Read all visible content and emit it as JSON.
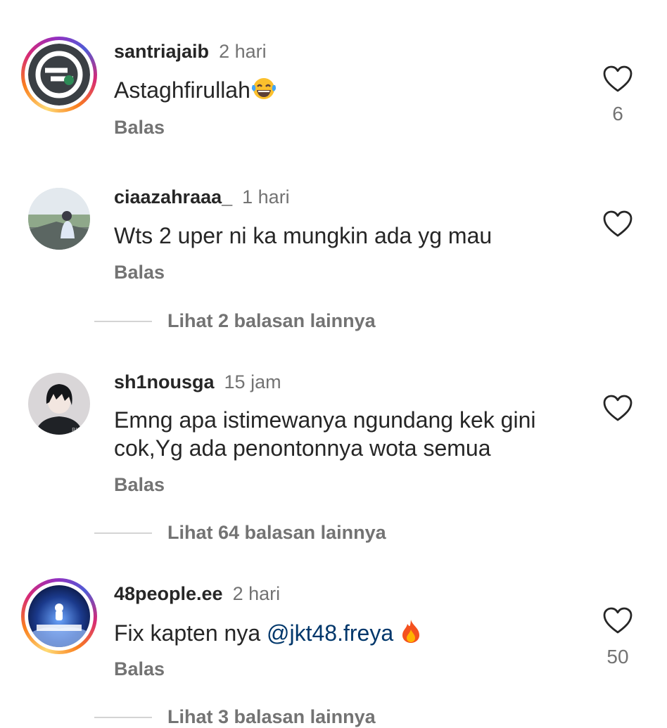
{
  "comments": [
    {
      "username": "santriajaib",
      "time": "2 hari",
      "text": "Astaghfirullah",
      "emoji": "tears-of-joy-emoji",
      "reply_label": "Balas",
      "likes": "6"
    },
    {
      "username": "ciaazahraaa_",
      "time": "1 hari",
      "text": "Wts 2 uper ni ka mungkin ada yg mau",
      "reply_label": "Balas",
      "view_replies": "Lihat 2 balasan lainnya"
    },
    {
      "username": "sh1nousga",
      "time": "15 jam",
      "text_line1": "Emng apa istimewanya ngundang kek gini",
      "text_line2": "cok,Yg ada penontonnya wota semua",
      "reply_label": "Balas",
      "view_replies": "Lihat 64 balasan lainnya"
    },
    {
      "username": "48people.ee",
      "time": "2 hari",
      "text": "Fix kapten nya ",
      "mention": "@jkt48.freya",
      "emoji": "fire-emoji",
      "reply_label": "Balas",
      "likes": "50",
      "view_replies": "Lihat 3 balasan lainnya"
    }
  ],
  "colors": {
    "text": "#262626",
    "secondary": "#737373",
    "mention": "#00376b",
    "divider": "#d4d4d4"
  },
  "icons": [
    "heart-outline-icon"
  ]
}
